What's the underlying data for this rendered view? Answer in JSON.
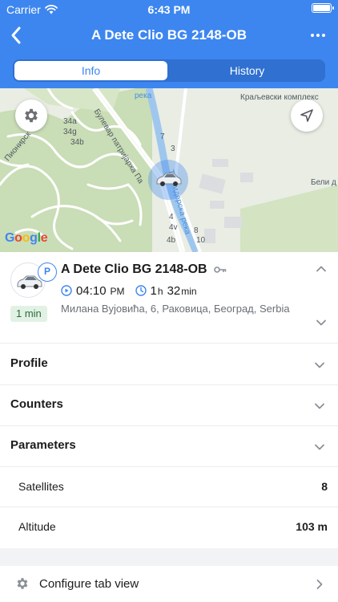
{
  "status_bar": {
    "carrier": "Carrier",
    "time": "6:43 PM",
    "battery_level": 0.9
  },
  "nav": {
    "title": "A Dete Clio BG 2148-OB",
    "back_icon": "chevron-left-icon",
    "more_icon": "more-dots-icon"
  },
  "tabs": [
    {
      "label": "Info",
      "selected": true
    },
    {
      "label": "History",
      "selected": false
    }
  ],
  "map": {
    "labels": {
      "boulevard": "Булевар патријарха Па",
      "river_short": "река",
      "river_long": "Топчидерска река",
      "royal": "Краљевски комплекс",
      "beli": "Бели д",
      "pionirska": "Пионирск",
      "n34a": "34a",
      "n34g": "34g",
      "n34b": "34b",
      "n3": "3",
      "n7": "7",
      "n4": "4",
      "n4v": "4v",
      "n4b": "4b",
      "n8": "8",
      "n10": "10"
    },
    "attribution": [
      "G",
      "o",
      "o",
      "g",
      "l",
      "e"
    ]
  },
  "unit": {
    "name": "A Dete Clio BG 2148-OB",
    "parking_badge": "P",
    "last_update": "1 min",
    "time_value": "04:10",
    "time_suffix": "PM",
    "duration_hours": "1",
    "duration_h_unit": "h",
    "duration_minutes": "32",
    "duration_min_unit": "min",
    "address": "Милана Вујовића, 6, Раковица, Београд, Serbia"
  },
  "sections": [
    {
      "label": "Profile"
    },
    {
      "label": "Counters"
    },
    {
      "label": "Parameters"
    }
  ],
  "parameters": [
    {
      "key": "Satellites",
      "value": "8"
    },
    {
      "key": "Altitude",
      "value": "103 m"
    }
  ],
  "footer": {
    "configure_label": "Configure tab view"
  },
  "colors": {
    "accent": "#3d86ef",
    "river": "#9fc7ee",
    "park": "#c9ddb6"
  }
}
